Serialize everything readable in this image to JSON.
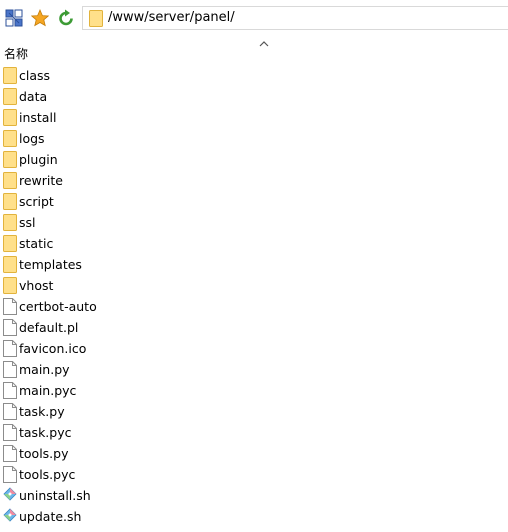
{
  "toolbar": {
    "buttons": [
      {
        "icon": "network-drive-icon"
      },
      {
        "icon": "star-icon"
      },
      {
        "icon": "refresh-icon"
      }
    ]
  },
  "address": {
    "path": "/www/server/panel/"
  },
  "list_header": {
    "name_column": "名称"
  },
  "files": [
    {
      "name": "class",
      "type": "folder"
    },
    {
      "name": "data",
      "type": "folder"
    },
    {
      "name": "install",
      "type": "folder"
    },
    {
      "name": "logs",
      "type": "folder"
    },
    {
      "name": "plugin",
      "type": "folder"
    },
    {
      "name": "rewrite",
      "type": "folder"
    },
    {
      "name": "script",
      "type": "folder"
    },
    {
      "name": "ssl",
      "type": "folder"
    },
    {
      "name": "static",
      "type": "folder"
    },
    {
      "name": "templates",
      "type": "folder"
    },
    {
      "name": "vhost",
      "type": "folder"
    },
    {
      "name": "certbot-auto",
      "type": "file"
    },
    {
      "name": "default.pl",
      "type": "file"
    },
    {
      "name": "favicon.ico",
      "type": "file"
    },
    {
      "name": "main.py",
      "type": "file"
    },
    {
      "name": "main.pyc",
      "type": "file"
    },
    {
      "name": "task.py",
      "type": "file"
    },
    {
      "name": "task.pyc",
      "type": "file"
    },
    {
      "name": "tools.py",
      "type": "file"
    },
    {
      "name": "tools.pyc",
      "type": "file"
    },
    {
      "name": "uninstall.sh",
      "type": "script"
    },
    {
      "name": "update.sh",
      "type": "script"
    }
  ],
  "colors": {
    "folder_fill": "#ffe08a",
    "folder_edge": "#e2b33c",
    "star": "#f5a623",
    "refresh": "#3d9b35",
    "border": "#d9d9d9"
  }
}
